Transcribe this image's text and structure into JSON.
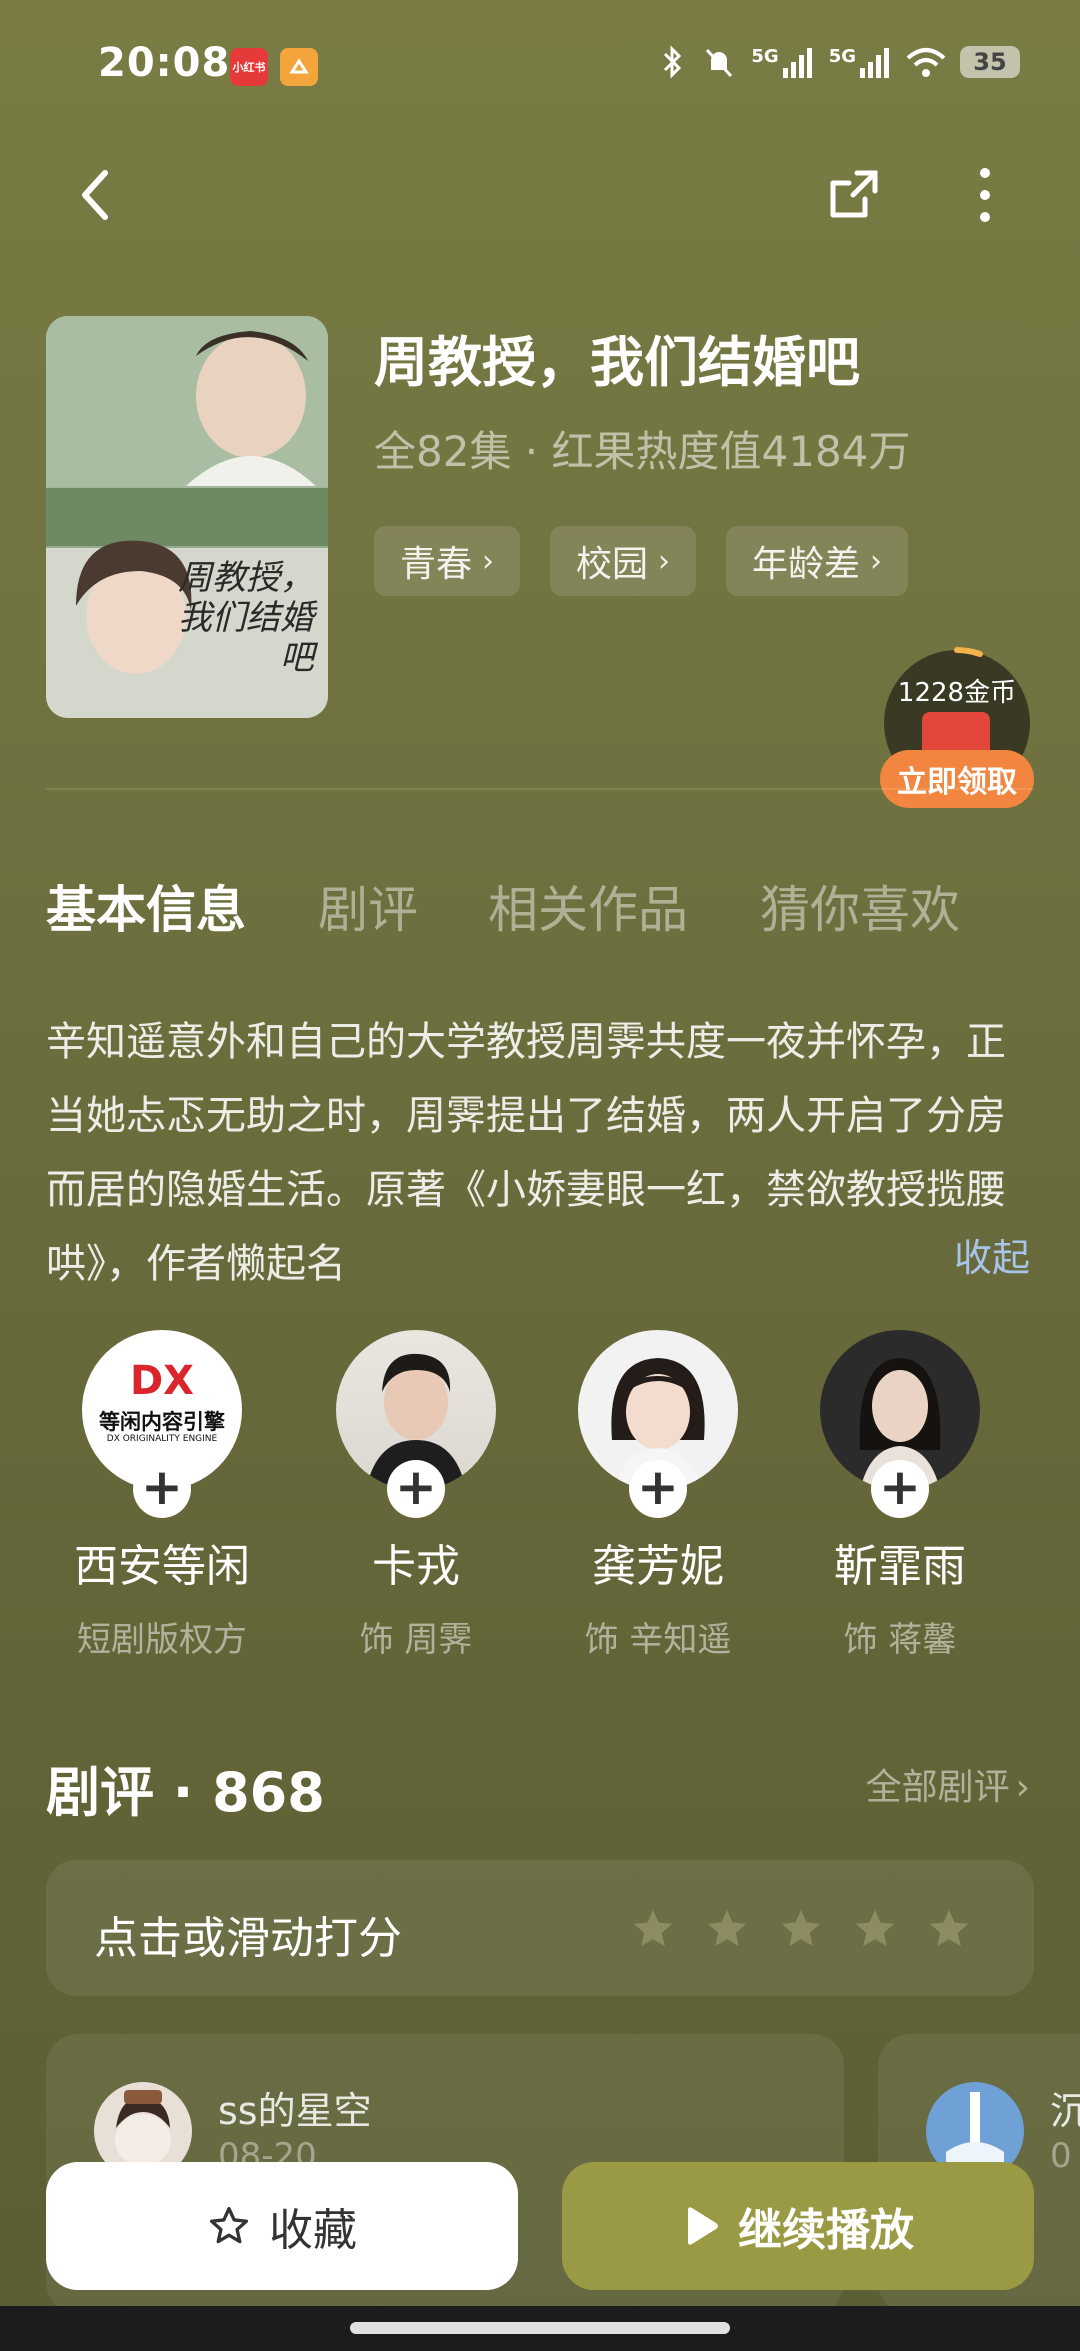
{
  "status_bar": {
    "time": "20:08",
    "app_badge_1": "小红书",
    "network_1": "5G",
    "network_2": "5G",
    "battery": "35"
  },
  "drama": {
    "title": "周教授，我们结婚吧",
    "meta": "全82集 · 红果热度值4184万",
    "tags": [
      "青春",
      "校园",
      "年龄差"
    ],
    "poster_title": "周教授，我们结婚吧"
  },
  "coin": {
    "amount": "1228金币",
    "button": "立即领取"
  },
  "tabs": [
    "基本信息",
    "剧评",
    "相关作品",
    "猜你喜欢"
  ],
  "synopsis": "辛知遥意外和自己的大学教授周霁共度一夜并怀孕，正当她忐忑无助之时，周霁提出了结婚，两人开启了分房而居的隐婚生活。原著《小娇妻眼一红，禁欲教授揽腰哄》，作者懒起名",
  "collapse_label": "收起",
  "cast": [
    {
      "name": "西安等闲",
      "role": "短剧版权方",
      "logo_line1": "等闲内容引擎",
      "logo_line2": "DX ORIGINALITY ENGINE",
      "logo_mark": "DX"
    },
    {
      "name": "卡戎",
      "role": "饰 周霁"
    },
    {
      "name": "龚芳妮",
      "role": "饰 辛知遥"
    },
    {
      "name": "靳霏雨",
      "role": "饰 蒋馨"
    }
  ],
  "reviews": {
    "title": "剧评 · 868",
    "all_label": "全部剧评",
    "rate_label": "点击或滑动打分",
    "first_user": "ss的星空",
    "first_date": "08-20",
    "second_user_initial": "沉",
    "second_date_initial": "0"
  },
  "actions": {
    "favorite": "收藏",
    "continue": "继续播放"
  },
  "colors": {
    "accent_button": "#9a9a45",
    "coin_button": "#f2853f",
    "link_blue": "#a8c4e8"
  }
}
